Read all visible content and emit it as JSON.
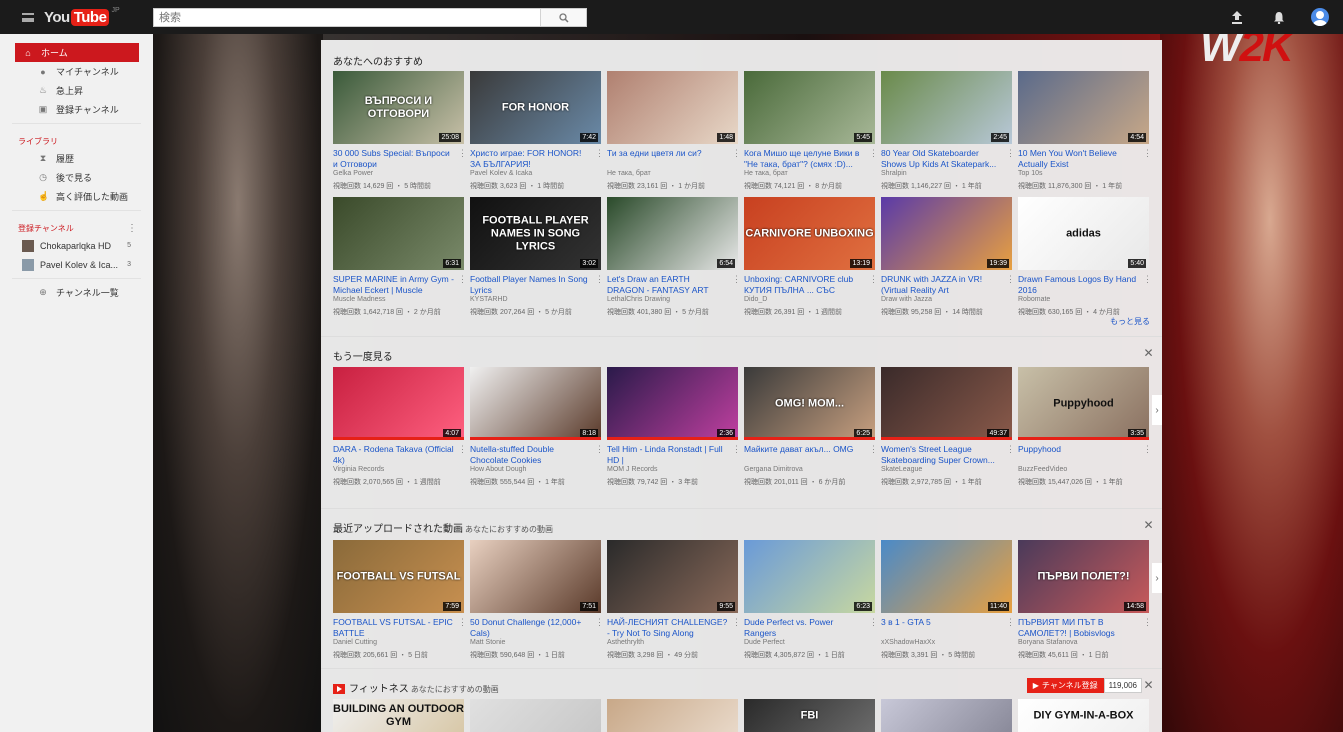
{
  "header": {
    "logo_you": "You",
    "logo_tube": "Tube",
    "logo_region": "JP",
    "search_placeholder": "検索"
  },
  "brand_overlay": {
    "part1": "W",
    "part2": "2K"
  },
  "sidebar": {
    "main": [
      {
        "label": "ホーム",
        "icon": "home-icon",
        "active": true
      },
      {
        "label": "マイチャンネル",
        "icon": "person-icon"
      },
      {
        "label": "急上昇",
        "icon": "flame-icon"
      },
      {
        "label": "登録チャンネル",
        "icon": "subscriptions-icon"
      }
    ],
    "library_title": "ライブラリ",
    "library": [
      {
        "label": "履歴",
        "icon": "hourglass-icon"
      },
      {
        "label": "後で見る",
        "icon": "clock-icon"
      },
      {
        "label": "高く評価した動画",
        "icon": "thumbs-up-icon"
      }
    ],
    "subs_title": "登録チャンネル",
    "subs": [
      {
        "label": "Chokaparlqka HD",
        "count": "5"
      },
      {
        "label": "Pavel Kolev & Ica...",
        "count": "3"
      }
    ],
    "browse_label": "チャンネル一覧"
  },
  "shelves": {
    "recommended": {
      "title": "あなたへのおすすめ",
      "more": "もっと見る",
      "row1": [
        {
          "title": "30 000 Subs Special: Въпроси и Отговори",
          "channel": "Gelka Power",
          "meta": "視聴回数 14,629 回 ・ 5 時間前",
          "dur": "25:08",
          "thumb": "ВЪПРОСИ И ОТГОВОРИ",
          "c1": "#3a5a3a",
          "c2": "#c8c0a8"
        },
        {
          "title": "Христо играе: FOR HONOR! ЗА БЪЛГАРИЯ!",
          "channel": "Pavel Kolev & Icaka",
          "meta": "視聴回数 3,623 回 ・ 1 時間前",
          "dur": "7:42",
          "thumb": "FOR HONOR",
          "c1": "#3a3a3a",
          "c2": "#6a8aa8"
        },
        {
          "title": "Ти за едни цветя ли си?",
          "channel": "Не така, брат",
          "meta": "視聴回数 23,161 回 ・ 1 か月前",
          "dur": "1:48",
          "thumb": "",
          "c1": "#b08070",
          "c2": "#e8d8c8"
        },
        {
          "title": "Кога Мишо ще целуне Вики в \"Не така, брат\"? (смях :D)...",
          "channel": "Не така, брат",
          "meta": "視聴回数 74,121 回 ・ 8 か月前",
          "dur": "5:45",
          "thumb": "",
          "c1": "#4a6a3a",
          "c2": "#a8b898"
        },
        {
          "title": "80 Year Old Skateboarder Shows Up Kids At Skatepark...",
          "channel": "Shralpin",
          "meta": "視聴回数 1,146,227 回 ・ 1 年前",
          "dur": "2:45",
          "thumb": "",
          "c1": "#6a8a4a",
          "c2": "#b8c8d8"
        },
        {
          "title": "10 Men You Won't Believe Actually Exist",
          "channel": "Top 10s",
          "meta": "視聴回数 11,876,300 回 ・ 1 年前",
          "dur": "4:54",
          "thumb": "",
          "c1": "#5a6a8a",
          "c2": "#c8a888"
        }
      ],
      "row2": [
        {
          "title": "SUPER MARINE in Army Gym - Michael Eckert | Muscle",
          "channel": "Muscle Madness",
          "meta": "視聴回数 1,642,718 回 ・ 2 か月前",
          "dur": "6:31",
          "thumb": "",
          "c1": "#3a4a2a",
          "c2": "#7a8a6a"
        },
        {
          "title": "Football Player Names In Song Lyrics",
          "channel": "KYSTARHD",
          "meta": "視聴回数 207,264 回 ・ 5 か月前",
          "dur": "3:02",
          "thumb": "FOOTBALL PLAYER NAMES IN SONG LYRICS",
          "c1": "#111111",
          "c2": "#333333"
        },
        {
          "title": "Let's Draw an EARTH DRAGON - FANTASY ART",
          "channel": "LethalChris Drawing",
          "meta": "視聴回数 401,380 回 ・ 5 か月前",
          "dur": "6:54",
          "thumb": "",
          "c1": "#2a4a2a",
          "c2": "#e8e8e8"
        },
        {
          "title": "Unboxing: CARNIVORE club КУТИЯ ПЪЛНА ... СЪС",
          "channel": "Dido_D",
          "meta": "視聴回数 26,391 回 ・ 1 週間前",
          "dur": "13:19",
          "thumb": "CARNIVORE UNBOXING",
          "c1": "#c84020",
          "c2": "#e07040"
        },
        {
          "title": "DRUNK with JAZZA in VR! (Virtual Reality Art",
          "channel": "Draw with Jazza",
          "meta": "視聴回数 95,258 回 ・ 14 時間前",
          "dur": "19:39",
          "thumb": "",
          "c1": "#5a3aa8",
          "c2": "#e8a040"
        },
        {
          "title": "Drawn Famous Logos By Hand 2016",
          "channel": "Robomate",
          "meta": "視聴回数 630,165 回 ・ 4 か月前",
          "dur": "5:40",
          "thumb": "adidas",
          "c1": "#ffffff",
          "c2": "#e8e8e8"
        }
      ]
    },
    "watch_again": {
      "title": "もう一度見る",
      "items": [
        {
          "title": "DARA - Rodena Takava (Official 4k)",
          "channel": "Virginia Records",
          "meta": "視聴回数 2,070,565 回 ・ 1 週間前",
          "dur": "4:07",
          "thumb": "",
          "c1": "#c82040",
          "c2": "#ff6080"
        },
        {
          "title": "Nutella-stuffed Double Chocolate Cookies",
          "channel": "How About Dough",
          "meta": "視聴回数 555,544 回 ・ 1 年前",
          "dur": "8:18",
          "thumb": "",
          "c1": "#f0f0f0",
          "c2": "#5a3a2a"
        },
        {
          "title": "Tell Him - Linda Ronstadt | Full HD |",
          "channel": "MOM J Records",
          "meta": "視聴回数 79,742 回 ・ 3 年前",
          "dur": "2:36",
          "thumb": "",
          "c1": "#2a1a4a",
          "c2": "#c040a0"
        },
        {
          "title": "Майките дават акъл... OMG",
          "channel": "Gergana Dimitrova",
          "meta": "視聴回数 201,011 回 ・ 6 か月前",
          "dur": "6:25",
          "thumb": "OMG! MOM...",
          "c1": "#3a3a3a",
          "c2": "#c8a080"
        },
        {
          "title": "Women's Street League Skateboarding Super Crown...",
          "channel": "SkateLeague",
          "meta": "視聴回数 2,972,785 回 ・ 1 年前",
          "dur": "49:37",
          "thumb": "",
          "c1": "#3a2a2a",
          "c2": "#8a5a4a"
        },
        {
          "title": "Puppyhood",
          "channel": "BuzzFeedVideo",
          "meta": "視聴回数 15,447,026 回 ・ 1 年前",
          "dur": "3:35",
          "thumb": "Puppyhood",
          "c1": "#c8c0a8",
          "c2": "#8a7060"
        }
      ]
    },
    "recent": {
      "title": "最近アップロードされた動画",
      "subtitle": "あなたにおすすめの動画",
      "items": [
        {
          "title": "FOOTBALL VS FUTSAL - EPIC BATTLE",
          "channel": "Daniel Cutting",
          "meta": "視聴回数 205,661 回 ・ 5 日前",
          "dur": "7:59",
          "thumb": "FOOTBALL VS FUTSAL",
          "c1": "#8a6a3a",
          "c2": "#c89050"
        },
        {
          "title": "50 Donut Challenge (12,000+ Cals)",
          "channel": "Matt Stonie",
          "meta": "視聴回数 590,648 回 ・ 1 日前",
          "dur": "7:51",
          "thumb": "",
          "c1": "#e8d0c0",
          "c2": "#5a3a2a"
        },
        {
          "title": "НАЙ-ЛЕСНИЯТ CHALLENGE? - Try Not To Sing Along",
          "channel": "Asthethrylth",
          "meta": "視聴回数 3,298 回 ・ 49 分前",
          "dur": "9:55",
          "thumb": "",
          "c1": "#2a2a2a",
          "c2": "#8a6a5a"
        },
        {
          "title": "Dude Perfect vs. Power Rangers",
          "channel": "Dude Perfect",
          "meta": "視聴回数 4,305,872 回 ・ 1 日前",
          "dur": "6:23",
          "thumb": "",
          "c1": "#6a9ad8",
          "c2": "#c8d8a0"
        },
        {
          "title": "3 в 1 - GTA 5",
          "channel": "xXShadowHaxXx",
          "meta": "視聴回数 3,391 回 ・ 5 時間前",
          "dur": "11:40",
          "thumb": "",
          "c1": "#4a8ac8",
          "c2": "#e8a040"
        },
        {
          "title": "ПЪРВИЯТ МИ ПЪТ В САМОЛЕТ?! | Bobisvlogs",
          "channel": "Boryana Stafanova",
          "meta": "視聴回数 45,611 回 ・ 1 日前",
          "dur": "14:58",
          "thumb": "ПЪРВИ ПОЛЕТ?!",
          "c1": "#4a3a5a",
          "c2": "#c85a5a"
        }
      ]
    },
    "fitness": {
      "title": "フィットネス",
      "subtitle": "あなたにおすすめの動画",
      "subscribe_label": "チャンネル登録",
      "subscriber_count": "119,006",
      "items": [
        {
          "thumb": "BUILDING AN OUTDOOR GYM",
          "c1": "#f0f0f0",
          "c2": "#d8c8a8"
        },
        {
          "thumb": "",
          "c1": "#e0e0e0",
          "c2": "#c8c8c8"
        },
        {
          "thumb": "",
          "c1": "#c8a888",
          "c2": "#e8d8c8"
        },
        {
          "thumb": "FBI",
          "c1": "#2a2a2a",
          "c2": "#6a6a6a"
        },
        {
          "thumb": "",
          "c1": "#c8c8d8",
          "c2": "#8a8a9a"
        },
        {
          "thumb": "DIY GYM-IN-A-BOX",
          "c1": "#ffffff",
          "c2": "#f0f0f0"
        }
      ]
    }
  }
}
